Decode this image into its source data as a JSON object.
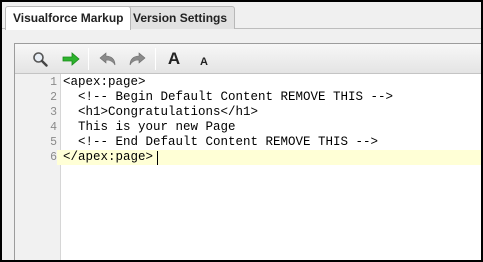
{
  "tabs": [
    {
      "label": "Visualforce Markup",
      "active": true
    },
    {
      "label": "Version Settings",
      "active": false
    }
  ],
  "toolbar": {
    "buttons": [
      {
        "icon": "search-icon"
      },
      {
        "icon": "go-to-line-arrow-icon"
      },
      {
        "icon": "undo-icon"
      },
      {
        "icon": "redo-icon"
      },
      {
        "icon": "increase-font-icon",
        "glyph": "A"
      },
      {
        "icon": "decrease-font-icon",
        "glyph": "A"
      }
    ]
  },
  "editor": {
    "current_line": 6,
    "lines": [
      {
        "num": "1",
        "text": "<apex:page>"
      },
      {
        "num": "2",
        "text": "  <!-- Begin Default Content REMOVE THIS -->"
      },
      {
        "num": "3",
        "text": "  <h1>Congratulations</h1>"
      },
      {
        "num": "4",
        "text": "  This is your new Page"
      },
      {
        "num": "5",
        "text": "  <!-- End Default Content REMOVE THIS -->"
      },
      {
        "num": "6",
        "text": "</apex:page>"
      }
    ]
  },
  "colors": {
    "current_line_bg": "#ffffd6",
    "gutter_bg": "#f1f1f1",
    "go_arrow": "#2db32d"
  }
}
